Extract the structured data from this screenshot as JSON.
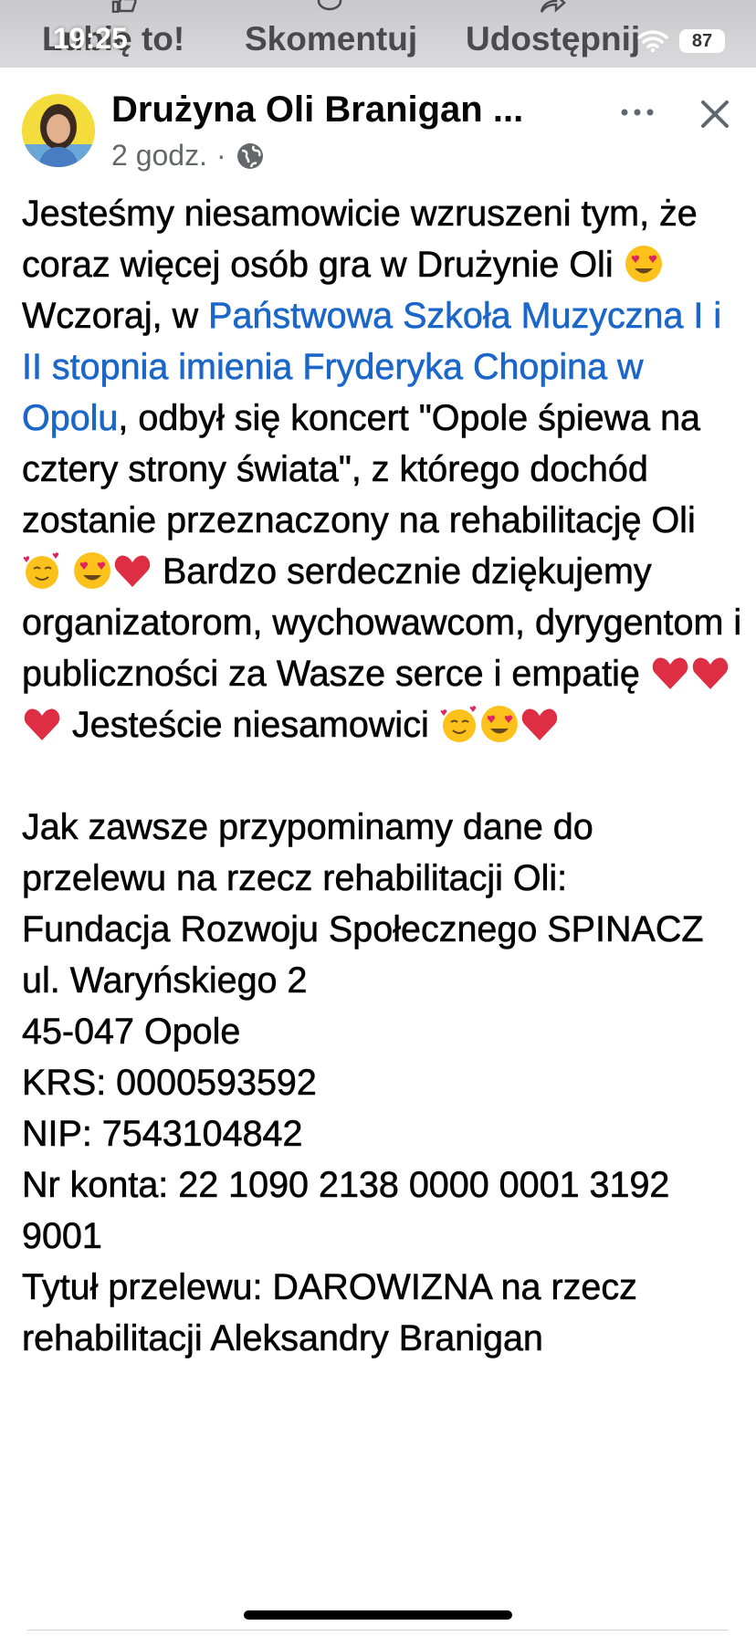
{
  "top_actions": {
    "like": "Lubię to!",
    "comment": "Skomentuj",
    "share": "Udostępnij"
  },
  "status_bar": {
    "time": "19:25",
    "battery": "87"
  },
  "post": {
    "author": "Drużyna Oli Branigan ...",
    "time": "2 godz.",
    "separator": "·",
    "audience_icon": "globe-icon",
    "text": {
      "s1": "Jesteśmy niesamowicie wzruszeni tym, że coraz więcej osób gra w Drużynie Oli ",
      "s2": " Wczoraj, w ",
      "link": "Państwowa Szkoła Muzyczna I i II stopnia imienia Fryderyka Chopina w Opolu",
      "s3": ", odbył się koncert \"Opole śpiewa na cztery strony świata\", z którego dochód zostanie przeznaczony na rehabilitację Oli ",
      "s4": " Bardzo serdecznie dziękujemy organizatorom, wychowawcom, dyrygentom i publiczności za Wasze serce i empatię ",
      "s5": " Jesteście niesamowici ",
      "l1": "Jak zawsze przypominamy dane do przelewu na rzecz rehabilitacji Oli:",
      "l2": "Fundacja Rozwoju Społecznego SPINACZ",
      "l3": "ul. Waryńskiego 2",
      "l4": "45-047 Opole",
      "l5": "KRS: 0000593592",
      "l6": "NIP: 7543104842",
      "l7": "Nr konta: 22 1090 2138 0000 0001 3192 9001",
      "l8": "Tytuł przelewu: DAROWIZNA na rzecz rehabilitacji Aleksandry Branigan"
    }
  },
  "colors": {
    "link": "#1b66c9",
    "meta": "#65676b",
    "text": "#050505"
  }
}
